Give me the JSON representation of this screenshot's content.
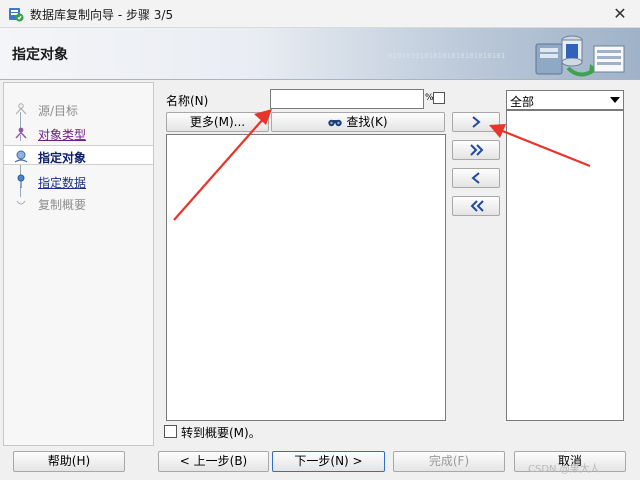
{
  "window": {
    "title": "数据库复制向导 - 步骤 3/5",
    "close_glyph": "✕"
  },
  "header": {
    "title": "指定对象",
    "binary_text": "01010101010101010101010101"
  },
  "steps": [
    {
      "label": "源/目标",
      "state": "disabled"
    },
    {
      "label": "对象类型",
      "state": "visited"
    },
    {
      "label": "指定对象",
      "state": "current"
    },
    {
      "label": "指定数据",
      "state": "link"
    },
    {
      "label": "复制概要",
      "state": "disabled"
    }
  ],
  "search": {
    "name_label": "名称(N)",
    "name_value": "",
    "percent_label": "%",
    "more_button": "更多(M)...",
    "find_button": "查找(K)"
  },
  "move_buttons": [
    {
      "name": "move-selected-right-button",
      "icon": "chevron-right-icon"
    },
    {
      "name": "move-all-right-button",
      "icon": "double-chevron-right-icon"
    },
    {
      "name": "move-selected-left-button",
      "icon": "chevron-left-icon"
    },
    {
      "name": "move-all-left-button",
      "icon": "double-chevron-left-icon"
    }
  ],
  "filter": {
    "selected": "全部"
  },
  "goto_summary": {
    "label": "转到概要(M)。",
    "checked": false
  },
  "buttons": {
    "help": "帮助(H)",
    "prev": "< 上一步(B)",
    "next": "下一步(N) >",
    "finish": "完成(F)",
    "cancel": "取消"
  },
  "watermark": "CSDN @果大人",
  "colors": {
    "annotation_arrow": "#e8342a",
    "focus_border": "#2f6fcf",
    "header_gradient_end": "#9fb2c8"
  }
}
